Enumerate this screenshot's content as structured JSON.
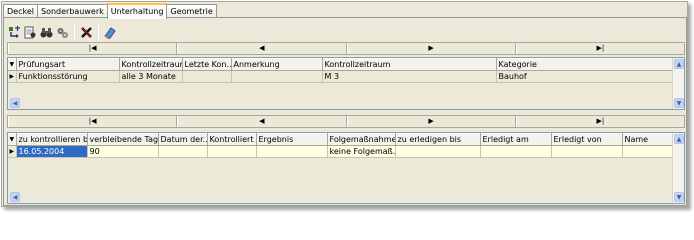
{
  "tabs": [
    {
      "label": "Deckel"
    },
    {
      "label": "Sonderbauwerk"
    },
    {
      "label": "Unterhaltung"
    },
    {
      "label": "Geometrie"
    }
  ],
  "nav": {
    "first": "|◀",
    "prev": "◀",
    "next": "▶",
    "last": "▶|"
  },
  "grid1": {
    "columns": [
      "Prüfungsart",
      "Kontrollzeitraum",
      "Letzte Kon...",
      "Anmerkung",
      "Kontrollzeitraum",
      "Kategorie"
    ],
    "rows": [
      [
        "Funktionsstörung",
        "alle 3 Monate",
        "",
        "",
        "M 3",
        "Bauhof"
      ]
    ]
  },
  "grid2": {
    "columns": [
      "zu kontrollieren bis",
      "verbleibende Tage",
      "Datum der...",
      "Kontrolliert ...",
      "Ergebnis",
      "Folgemaßnahme",
      "zu erledigen bis",
      "Erledigt am",
      "Erledigt von",
      "Name"
    ],
    "rows": [
      [
        "16.05.2004",
        "90",
        "",
        "",
        "",
        "keine Folgemaß...",
        "",
        "",
        "",
        ""
      ]
    ]
  },
  "colors": {
    "selection": "#316ac5",
    "row_highlight": "#ffffe1",
    "active_tab_accent": "#ffc83c"
  }
}
